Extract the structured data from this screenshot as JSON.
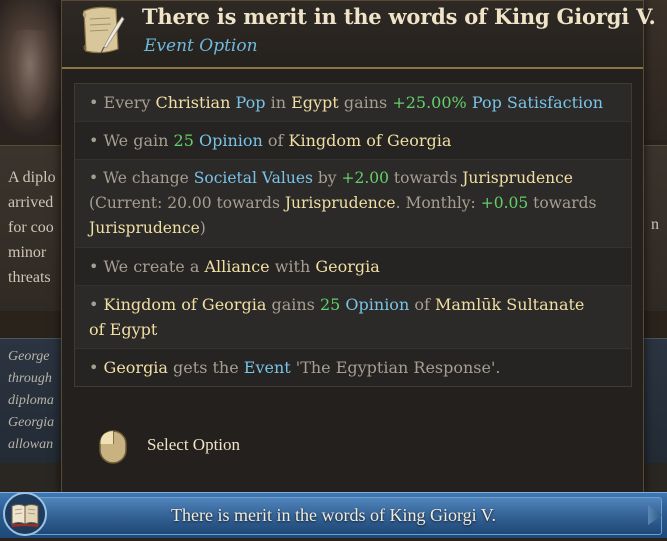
{
  "tooltip": {
    "title": "There is merit in the words of King Giorgi V.",
    "subtitle": "Event Option",
    "select_label": "Select Option"
  },
  "effects": [
    {
      "parts": [
        {
          "t": "• Every ",
          "c": "normal"
        },
        {
          "t": "Christian",
          "c": "hl-y"
        },
        {
          "t": " ",
          "c": "normal"
        },
        {
          "t": "Pop",
          "c": "hl-b"
        },
        {
          "t": " in ",
          "c": "normal"
        },
        {
          "t": "Egypt",
          "c": "hl-y"
        },
        {
          "t": " gains ",
          "c": "normal"
        },
        {
          "t": "+25.00%",
          "c": "hl-g"
        },
        {
          "t": " ",
          "c": "normal"
        },
        {
          "t": "Pop Satisfaction",
          "c": "hl-b"
        }
      ]
    },
    {
      "parts": [
        {
          "t": "• We gain ",
          "c": "normal"
        },
        {
          "t": "25",
          "c": "hl-g"
        },
        {
          "t": " ",
          "c": "normal"
        },
        {
          "t": "Opinion",
          "c": "hl-b"
        },
        {
          "t": " of ",
          "c": "normal"
        },
        {
          "t": "Kingdom of Georgia",
          "c": "hl-y"
        }
      ]
    },
    {
      "parts": [
        {
          "t": "• We change ",
          "c": "normal"
        },
        {
          "t": "Societal Values",
          "c": "hl-b"
        },
        {
          "t": " by ",
          "c": "normal"
        },
        {
          "t": "+2.00",
          "c": "hl-g"
        },
        {
          "t": " towards ",
          "c": "normal"
        },
        {
          "t": "Jurisprudence",
          "c": "hl-y"
        },
        {
          "t": "\n",
          "c": "normal"
        },
        {
          "t": "(Current: 20.00 towards ",
          "c": "normal"
        },
        {
          "t": "Jurisprudence",
          "c": "hl-y"
        },
        {
          "t": ". Monthly: ",
          "c": "normal"
        },
        {
          "t": "+0.05",
          "c": "hl-g"
        },
        {
          "t": " towards",
          "c": "normal"
        },
        {
          "t": "\n",
          "c": "normal"
        },
        {
          "t": "Jurisprudence",
          "c": "hl-y"
        },
        {
          "t": ")",
          "c": "normal"
        }
      ]
    },
    {
      "parts": [
        {
          "t": "• We create a ",
          "c": "normal"
        },
        {
          "t": "Alliance",
          "c": "hl-y"
        },
        {
          "t": " with ",
          "c": "normal"
        },
        {
          "t": "Georgia",
          "c": "hl-y"
        }
      ]
    },
    {
      "parts": [
        {
          "t": "• ",
          "c": "normal"
        },
        {
          "t": "Kingdom of Georgia",
          "c": "hl-y"
        },
        {
          "t": " gains ",
          "c": "normal"
        },
        {
          "t": "25",
          "c": "hl-g"
        },
        {
          "t": " ",
          "c": "normal"
        },
        {
          "t": "Opinion",
          "c": "hl-b"
        },
        {
          "t": " of ",
          "c": "normal"
        },
        {
          "t": "Mamlūk Sultanate",
          "c": "hl-y"
        },
        {
          "t": "\n",
          "c": "normal"
        },
        {
          "t": "of Egypt",
          "c": "hl-y"
        }
      ]
    },
    {
      "parts": [
        {
          "t": "• ",
          "c": "normal"
        },
        {
          "t": "Georgia",
          "c": "hl-y"
        },
        {
          "t": " gets the ",
          "c": "normal"
        },
        {
          "t": "Event",
          "c": "hl-b"
        },
        {
          "t": " 'The Egyptian Response'.",
          "c": "normal"
        }
      ]
    }
  ],
  "background": {
    "lines": [
      "A diplo",
      "arrived",
      "for coo",
      "minor",
      "threats"
    ],
    "right_letter": "n",
    "italic_lines": [
      "George",
      "through",
      "diploma",
      "Georgia",
      "allowan"
    ]
  },
  "option_bar": {
    "label": "There is merit in the words of King Giorgi V."
  },
  "colors": {
    "highlight_yellow": "#f1dfa4",
    "highlight_blue": "#79c3e6",
    "highlight_green": "#64d06a",
    "option_bar_blue": "#2a5a8f"
  }
}
